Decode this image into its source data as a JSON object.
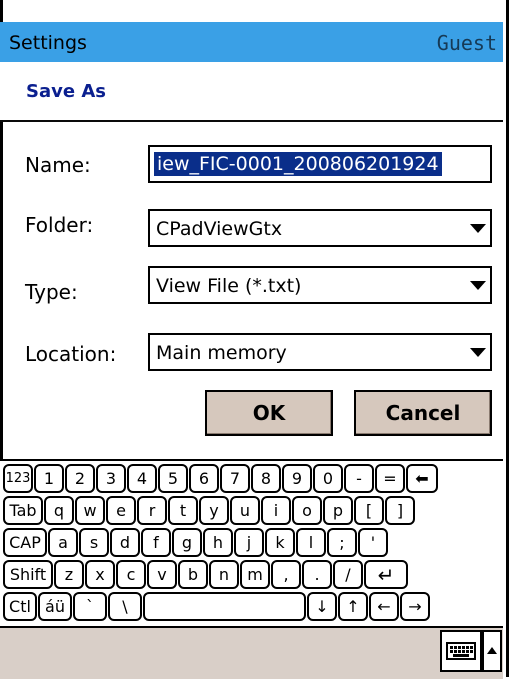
{
  "titlebar": {
    "title": "Settings",
    "user": "Guest"
  },
  "dialog": {
    "heading": "Save As",
    "fields": [
      {
        "label": "Name:",
        "value": "iew_FIC-0001_200806201924"
      },
      {
        "label": "Folder:",
        "value": "CPadViewGtx"
      },
      {
        "label": "Type:",
        "value": "View File (*.txt)"
      },
      {
        "label": "Location:",
        "value": "Main memory"
      }
    ],
    "ok_label": "OK",
    "cancel_label": "Cancel"
  },
  "keyboard": {
    "row1": [
      "123",
      "1",
      "2",
      "3",
      "4",
      "5",
      "6",
      "7",
      "8",
      "9",
      "0",
      "-",
      "=",
      "⬅"
    ],
    "row2": [
      "Tab",
      "q",
      "w",
      "e",
      "r",
      "t",
      "y",
      "u",
      "i",
      "o",
      "p",
      "[",
      "]"
    ],
    "row3": [
      "CAP",
      "a",
      "s",
      "d",
      "f",
      "g",
      "h",
      "j",
      "k",
      "l",
      ";",
      "'"
    ],
    "row4": [
      "Shift",
      "z",
      "x",
      "c",
      "v",
      "b",
      "n",
      "m",
      ",",
      ".",
      "/",
      "↵"
    ],
    "row5": [
      "Ctl",
      "áü",
      "`",
      "\\",
      "",
      "↓",
      "↑",
      "←",
      "→"
    ]
  },
  "icons": {
    "sip": "keyboard-icon",
    "sip_menu": "sip-arrow-icon"
  }
}
